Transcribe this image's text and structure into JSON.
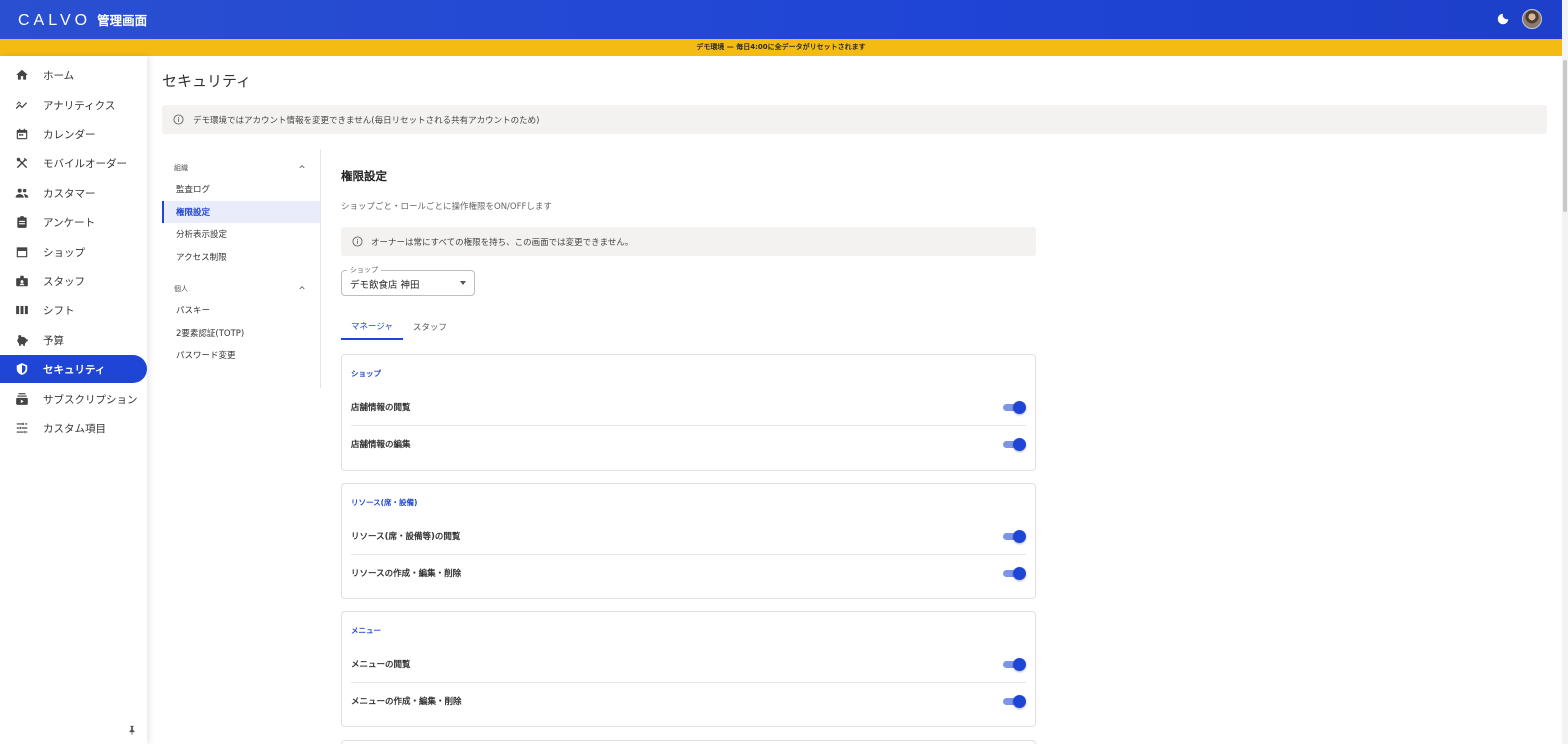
{
  "app": {
    "logo": "CALVO",
    "subtitle": "管理画面"
  },
  "banner": {
    "text": "デモ環境 — 毎日4:00に全データがリセットされます"
  },
  "sidebar": {
    "items": [
      {
        "label": "ホーム",
        "icon": "home-icon"
      },
      {
        "label": "アナリティクス",
        "icon": "analytics-icon"
      },
      {
        "label": "カレンダー",
        "icon": "calendar-icon"
      },
      {
        "label": "モバイルオーダー",
        "icon": "cutlery-icon"
      },
      {
        "label": "カスタマー",
        "icon": "people-icon"
      },
      {
        "label": "アンケート",
        "icon": "clipboard-icon"
      },
      {
        "label": "ショップ",
        "icon": "store-icon"
      },
      {
        "label": "スタッフ",
        "icon": "badge-icon"
      },
      {
        "label": "シフト",
        "icon": "columns-icon"
      },
      {
        "label": "予算",
        "icon": "piggy-bank-icon"
      },
      {
        "label": "セキュリティ",
        "icon": "shield-icon",
        "active": true
      },
      {
        "label": "サブスクリプション",
        "icon": "subscriptions-icon"
      },
      {
        "label": "カスタム項目",
        "icon": "tune-icon"
      }
    ],
    "accent": "#1f45d6"
  },
  "page": {
    "title": "セキュリティ",
    "alert": "デモ環境ではアカウント情報を変更できません(毎日リセットされる共有アカウントのため)"
  },
  "subnav": {
    "groups": [
      {
        "label": "組織",
        "items": [
          "監査ログ",
          "権限設定",
          "分析表示設定",
          "アクセス制限"
        ]
      },
      {
        "label": "個人",
        "items": [
          "パスキー",
          "2要素認証(TOTP)",
          "パスワード変更"
        ]
      }
    ],
    "active": "権限設定"
  },
  "permissions": {
    "title": "権限設定",
    "description": "ショップごと・ロールごとに操作権限をON/OFFします",
    "owner_note": "オーナーは常にすべての権限を持ち、この画面では変更できません。",
    "shop_select": {
      "label": "ショップ",
      "value": "デモ飲食店 神田"
    },
    "tabs": [
      {
        "label": "マネージャ",
        "active": true
      },
      {
        "label": "スタッフ",
        "active": false
      }
    ],
    "sections": [
      {
        "title": "ショップ",
        "rows": [
          {
            "label": "店舗情報の閲覧",
            "on": true
          },
          {
            "label": "店舗情報の編集",
            "on": true
          }
        ]
      },
      {
        "title": "リソース(席・設備)",
        "rows": [
          {
            "label": "リソース(席・設備等)の閲覧",
            "on": true
          },
          {
            "label": "リソースの作成・編集・削除",
            "on": true
          }
        ]
      },
      {
        "title": "メニュー",
        "rows": [
          {
            "label": "メニューの閲覧",
            "on": true
          },
          {
            "label": "メニューの作成・編集・削除",
            "on": true
          }
        ]
      }
    ]
  },
  "colors": {
    "primary": "#1f45d6",
    "banner": "#f4bc12",
    "alert_bg": "#f3f2f1"
  }
}
